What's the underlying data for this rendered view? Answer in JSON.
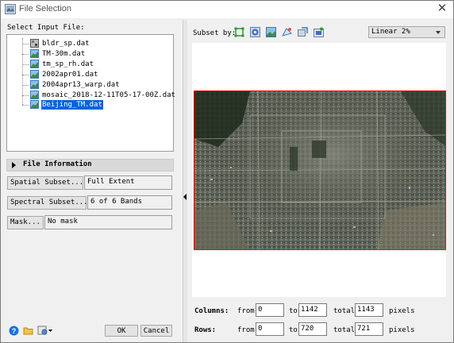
{
  "window": {
    "title": "File Selection",
    "close_glyph": "✕"
  },
  "input": {
    "label": "Select Input File:",
    "files": [
      {
        "name": "bldr_sp.dat",
        "icon": "grayscale-image-icon",
        "selected": false
      },
      {
        "name": "TM-30m.dat",
        "icon": "color-image-icon",
        "selected": false
      },
      {
        "name": "tm_sp_rh.dat",
        "icon": "color-image-icon",
        "selected": false
      },
      {
        "name": "2002apr01.dat",
        "icon": "color-image-icon",
        "selected": false
      },
      {
        "name": "2004apr13_warp.dat",
        "icon": "color-image-icon",
        "selected": false
      },
      {
        "name": "mosaic_2018-12-11T05-17-00Z.dat",
        "icon": "color-image-icon",
        "selected": false
      },
      {
        "name": "Beijing_TM.dat",
        "icon": "color-image-icon",
        "selected": true
      }
    ]
  },
  "file_info": {
    "label": "File Information"
  },
  "spatial_subset": {
    "button": "Spatial Subset...",
    "value": "Full Extent"
  },
  "spectral_subset": {
    "button": "Spectral Subset...",
    "value": "6 of 6 Bands"
  },
  "mask": {
    "button": "Mask...",
    "value": "No mask"
  },
  "footer": {
    "ok": "OK",
    "cancel": "Cancel",
    "icons": [
      "help-icon",
      "open-folder-icon",
      "options-icon"
    ]
  },
  "subset": {
    "label": "Subset by:",
    "icons": [
      "image-subset-icon",
      "map-subset-icon",
      "file-subset-icon",
      "roi-subset-icon",
      "vector-subset-icon",
      "view-subset-icon"
    ]
  },
  "stretch": {
    "selected": "Linear 2%"
  },
  "columns": {
    "label": "Columns:",
    "from_label": "from",
    "from": "0",
    "to_label": "to",
    "to": "1142",
    "total_label": "total",
    "total": "1143",
    "unit": "pixels"
  },
  "rows": {
    "label": "Rows:",
    "from_label": "from",
    "from": "0",
    "to_label": "to",
    "to": "720",
    "total_label": "total",
    "total": "721",
    "unit": "pixels"
  },
  "colors": {
    "selection": "#0a64d8",
    "subset_border": "#ff0000",
    "panel": "#f0f0f0"
  }
}
